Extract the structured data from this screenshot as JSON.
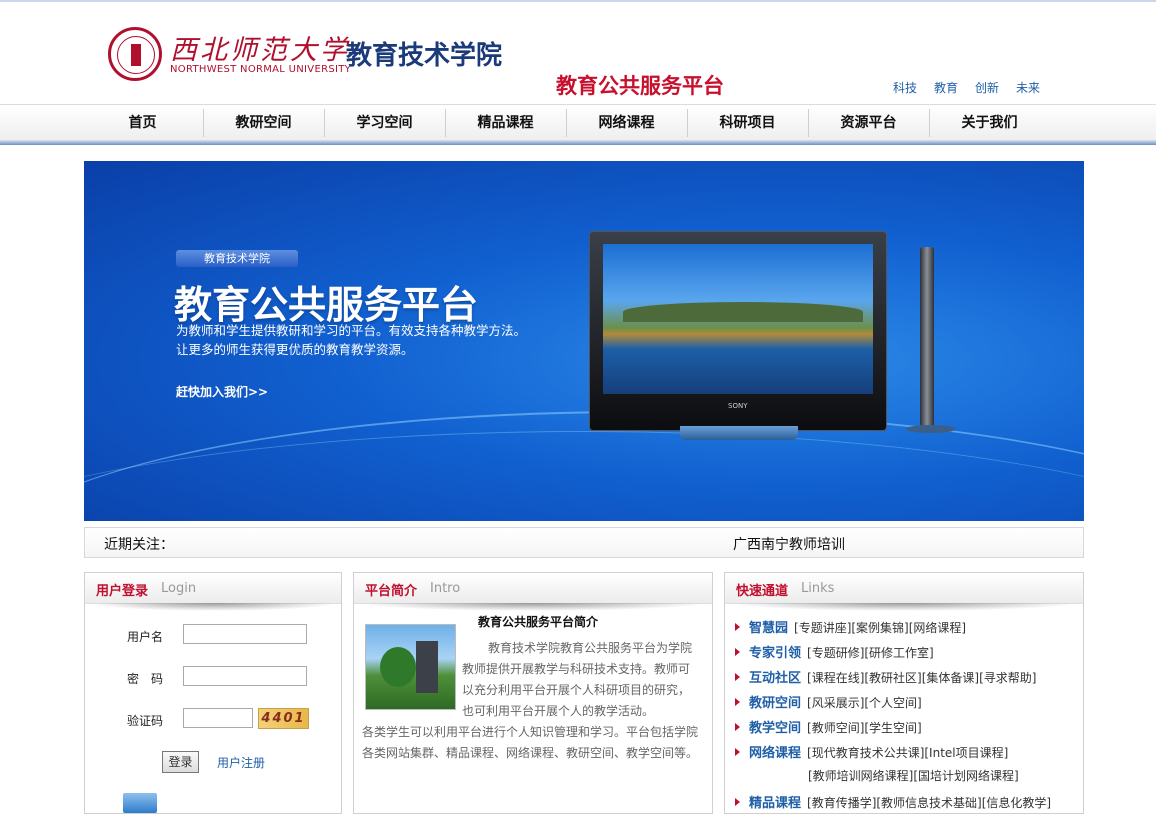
{
  "header": {
    "university_cn": "西北师范大学",
    "university_en": "NORTHWEST NORMAL UNIVERSITY",
    "college": "教育技术学院",
    "platform": "教育公共服务平台",
    "tags": [
      "科技",
      "教育",
      "创新",
      "未来"
    ]
  },
  "nav": [
    "首页",
    "教研空间",
    "学习空间",
    "精品课程",
    "网络课程",
    "科研项目",
    "资源平台",
    "关于我们"
  ],
  "banner": {
    "tag": "教育技术学院",
    "title": "教育公共服务平台",
    "desc_line1": "为教师和学生提供教研和学习的平台。有效支持各种教学方法。",
    "desc_line2": "让更多的师生获得更优质的教育教学资源。",
    "join": "赶快加入我们>>",
    "tv_brand": "SONY"
  },
  "notice": {
    "label": "近期关注：",
    "text": "广西南宁教师培训"
  },
  "login": {
    "title_cn": "用户登录",
    "title_en": "Login",
    "username_label": "用户名",
    "password_label": "密　码",
    "captcha_label": "验证码",
    "captcha_text": "4401",
    "login_button": "登录",
    "register_link": "用户注册"
  },
  "intro": {
    "title_cn": "平台简介",
    "title_en": "Intro",
    "heading": "教育公共服务平台简介",
    "para1": "教育技术学院教育公共服务平台为学院教师提供开展教学与科研技术支持。教师可以充分利用平台开展个人科研项目的研究，也可利用平台开展个人的教学活动。",
    "para2": "各类学生可以利用平台进行个人知识管理和学习。平台包括学院各类网站集群、精品课程、网络课程、教研空间、教学空间等。"
  },
  "links": {
    "title_cn": "快速通道",
    "title_en": "Links",
    "rows": [
      {
        "name": "智慧园",
        "items": "[专题讲座][案例集锦][网络课程]"
      },
      {
        "name": "专家引领",
        "items": "[专题研修][研修工作室]"
      },
      {
        "name": "互动社区",
        "items": "[课程在线][教研社区][集体备课][寻求帮助]"
      },
      {
        "name": "教研空间",
        "items": "[风采展示][个人空间]"
      },
      {
        "name": "教学空间",
        "items": "[教师空间][学生空间]"
      },
      {
        "name": "网络课程",
        "items": "[现代教育技术公共课][Intel项目课程]"
      },
      {
        "name": "",
        "items": "[教师培训网络课程][国培计划网络课程]"
      },
      {
        "name": "精品课程",
        "items": "[教育传播学][教师信息技术基础][信息化教学]"
      }
    ]
  }
}
